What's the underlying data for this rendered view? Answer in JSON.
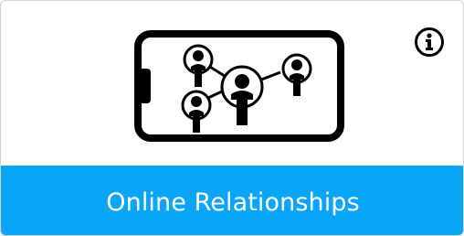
{
  "card": {
    "title": "Online Relationships",
    "illustration_icon": "smartphone-social-network-icon",
    "info_icon": "info-circle-icon",
    "footer_color": "#0aa5f7"
  }
}
